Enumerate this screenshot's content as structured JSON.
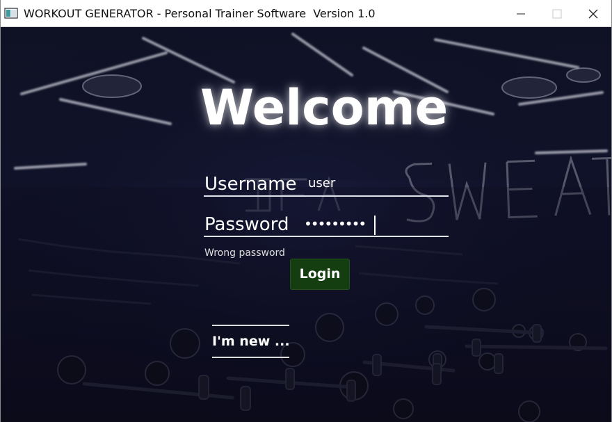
{
  "window": {
    "title": "WORKOUT GENERATOR - Personal Trainer Software  Version 1.0",
    "controls": [
      {
        "name": "minimize",
        "icon": "minimize-icon"
      },
      {
        "name": "maximize",
        "icon": "maximize-icon"
      },
      {
        "name": "close",
        "icon": "close-icon"
      }
    ]
  },
  "login": {
    "heading": "Welcome",
    "username_label": "Username",
    "username_value": "user",
    "password_label": "Password",
    "password_value": "•••••••••",
    "error_message": "Wrong password",
    "login_button": "Login",
    "new_user_link": "I'm new ..."
  },
  "background": {
    "wall_sign": "SWEAT",
    "colors": {
      "background_dark": "#111327",
      "neon_glow": "#dddde8",
      "button_green": "#143e0f"
    }
  }
}
